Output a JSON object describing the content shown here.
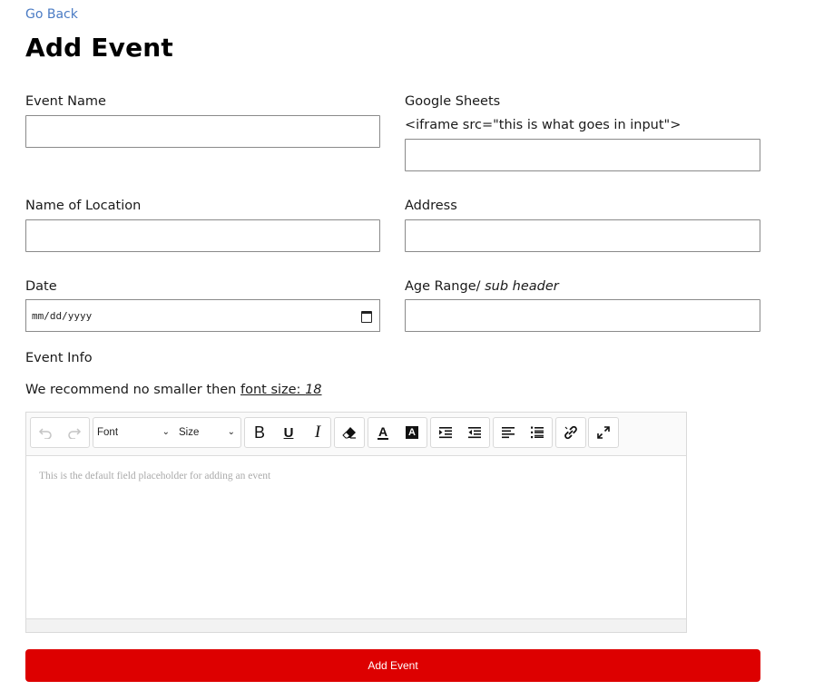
{
  "nav": {
    "go_back": "Go Back"
  },
  "page": {
    "title": "Add Event"
  },
  "fields": {
    "event_name": {
      "label": "Event Name",
      "value": ""
    },
    "google_sheets": {
      "label": "Google Sheets",
      "hint": "<iframe src=\"this is what goes in input\">",
      "value": ""
    },
    "location_name": {
      "label": "Name of Location",
      "value": ""
    },
    "address": {
      "label": "Address",
      "value": ""
    },
    "date": {
      "label": "Date",
      "placeholder": "mm/dd/yyyy"
    },
    "age_range": {
      "label": "Age Range/",
      "label_em": "sub header",
      "value": ""
    }
  },
  "event_info": {
    "label": "Event Info",
    "recommend_text": "We recommend no smaller then ",
    "font_size_label": "font size: ",
    "font_size_value": "18"
  },
  "editor": {
    "toolbar": {
      "font_select": "Font",
      "size_select": "Size"
    },
    "placeholder": "This is the default field placeholder for adding an event"
  },
  "submit": {
    "label": "Add Event"
  },
  "colors": {
    "accent": "#dd0000",
    "link": "#4a7bc4"
  }
}
